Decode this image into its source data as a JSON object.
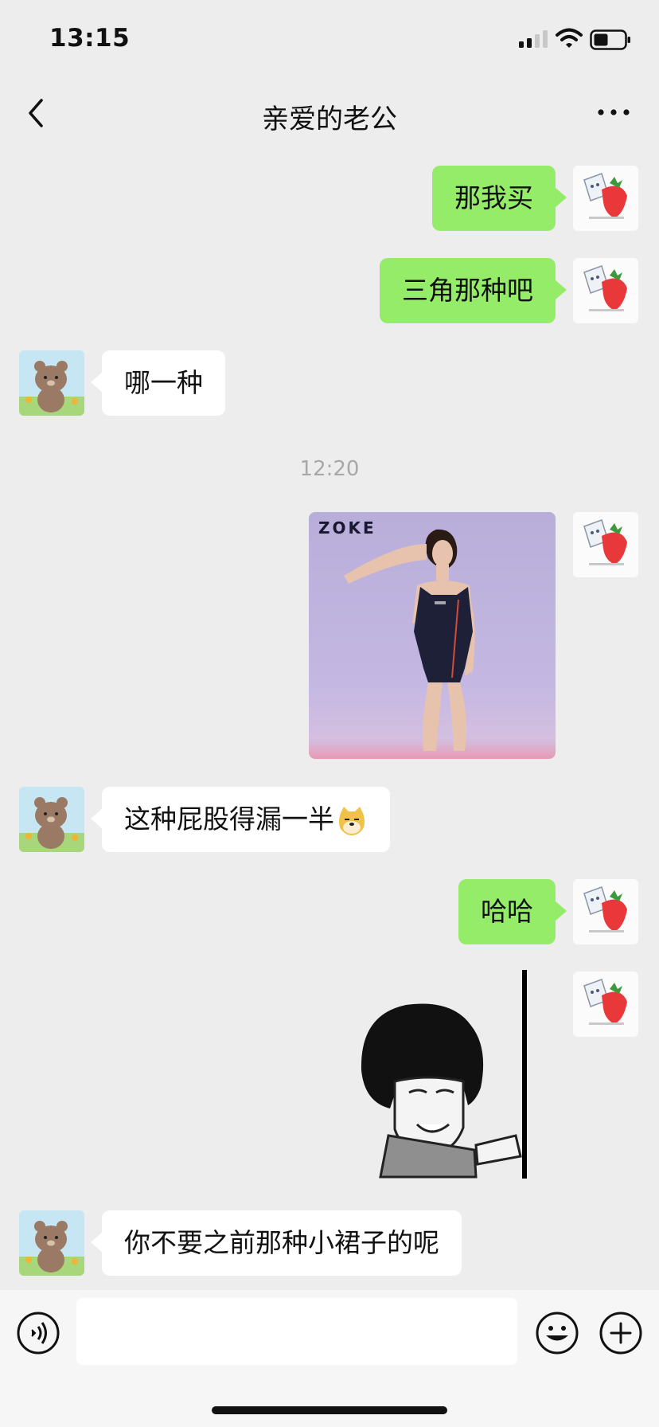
{
  "status_bar": {
    "time": "13:15"
  },
  "nav": {
    "title": "亲爱的老公"
  },
  "messages": [
    {
      "text": "那我买"
    },
    {
      "text": "三角那种吧"
    },
    {
      "text": "哪一种"
    },
    {
      "text": "12:20"
    },
    {
      "text": "ZOKE"
    },
    {
      "text": "这种屁股得漏一半"
    },
    {
      "text": "哈哈"
    },
    {
      "text": "你不要之前那种小裙子的呢"
    }
  ],
  "colors": {
    "my_bubble": "#95ec69",
    "other_bubble": "#ffffff",
    "background": "#ededed"
  },
  "icons": [
    "back-icon",
    "more-icon",
    "voice-icon",
    "emoji-icon",
    "plus-icon",
    "signal-icon",
    "wifi-icon",
    "battery-icon"
  ]
}
